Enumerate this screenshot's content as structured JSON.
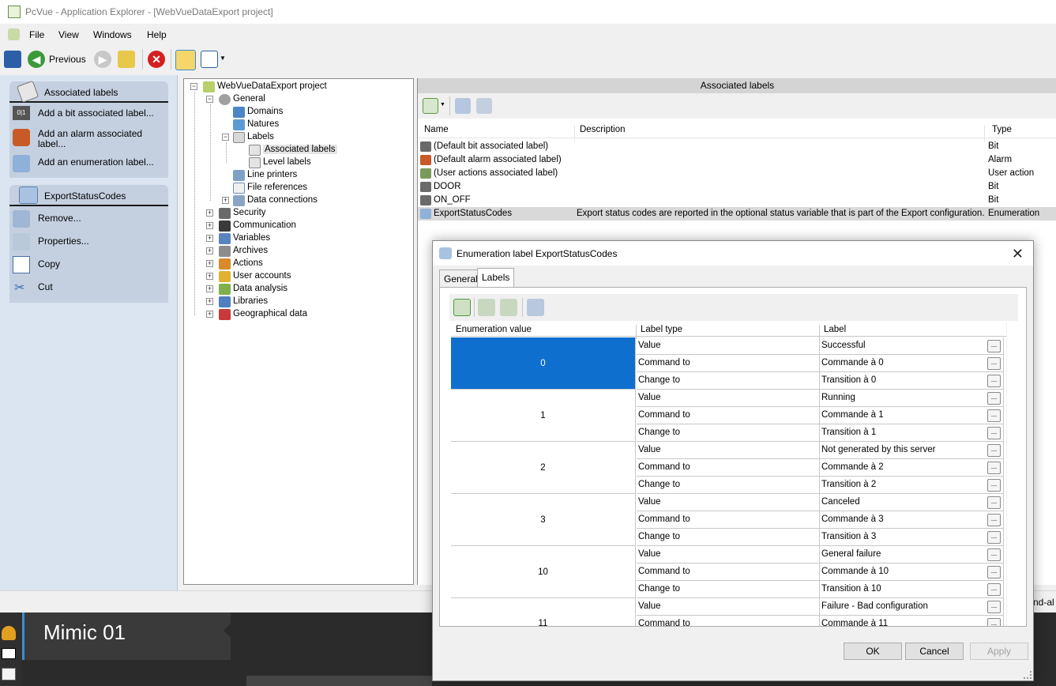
{
  "window": {
    "title": "PcVue - Application Explorer - [WebVueDataExport project]"
  },
  "menu": [
    "File",
    "View",
    "Windows",
    "Help"
  ],
  "toolbar": {
    "previous_label": "Previous"
  },
  "action_pane": {
    "group1": {
      "title": "Associated labels",
      "items": [
        "Add a bit associated label...",
        "Add an alarm associated label...",
        "Add an enumeration label..."
      ]
    },
    "group2": {
      "title": "ExportStatusCodes",
      "items": [
        "Remove...",
        "Properties...",
        "Copy",
        "Cut"
      ]
    }
  },
  "tree": {
    "root": "WebVueDataExport project",
    "general": "General",
    "general_children": [
      "Domains",
      "Natures",
      "Labels"
    ],
    "labels_children": [
      "Associated labels",
      "Level labels"
    ],
    "general_rest": [
      "Line printers",
      "File references",
      "Data connections"
    ],
    "top_level": [
      "Security",
      "Communication",
      "Variables",
      "Archives",
      "Actions",
      "User accounts",
      "Data analysis",
      "Libraries",
      "Geographical data"
    ]
  },
  "list": {
    "header": "Associated labels",
    "columns": {
      "name": "Name",
      "description": "Description",
      "type": "Type"
    },
    "rows": [
      {
        "name": "(Default bit associated label)",
        "description": "",
        "type": "Bit"
      },
      {
        "name": "(Default alarm associated label)",
        "description": "",
        "type": "Alarm"
      },
      {
        "name": "(User actions associated label)",
        "description": "",
        "type": "User action"
      },
      {
        "name": "DOOR",
        "description": "",
        "type": "Bit"
      },
      {
        "name": "ON_OFF",
        "description": "",
        "type": "Bit"
      },
      {
        "name": "ExportStatusCodes",
        "description": "Export status codes are reported in the optional status variable that is part of the Export configuration.",
        "type": "Enumeration"
      }
    ]
  },
  "status_bar": {
    "right_text": "nd-al"
  },
  "mimic": {
    "title": "Mimic 01"
  },
  "dialog": {
    "title": "Enumeration label ExportStatusCodes",
    "tabs": [
      "General",
      "Labels"
    ],
    "columns": {
      "enum": "Enumeration value",
      "type": "Label type",
      "label": "Label"
    },
    "groups": [
      {
        "value": "0",
        "rows": [
          [
            "Value",
            "Successful"
          ],
          [
            "Command to",
            "Commande à 0"
          ],
          [
            "Change to",
            "Transition à 0"
          ]
        ]
      },
      {
        "value": "1",
        "rows": [
          [
            "Value",
            "Running"
          ],
          [
            "Command to",
            "Commande à 1"
          ],
          [
            "Change to",
            "Transition à 1"
          ]
        ]
      },
      {
        "value": "2",
        "rows": [
          [
            "Value",
            "Not generated by this server"
          ],
          [
            "Command to",
            "Commande à 2"
          ],
          [
            "Change to",
            "Transition à 2"
          ]
        ]
      },
      {
        "value": "3",
        "rows": [
          [
            "Value",
            "Canceled"
          ],
          [
            "Command to",
            "Commande à 3"
          ],
          [
            "Change to",
            "Transition à 3"
          ]
        ]
      },
      {
        "value": "10",
        "rows": [
          [
            "Value",
            "General failure"
          ],
          [
            "Command to",
            "Commande à 10"
          ],
          [
            "Change to",
            "Transition à 10"
          ]
        ]
      },
      {
        "value": "11",
        "rows": [
          [
            "Value",
            "Failure - Bad configuration"
          ],
          [
            "Command to",
            "Commande à 11"
          ]
        ]
      }
    ],
    "buttons": {
      "ok": "OK",
      "cancel": "Cancel",
      "apply": "Apply"
    },
    "ellipsis": "..."
  },
  "colors": {
    "selection": "#0f6fcf",
    "accent": "#3b8fd1"
  }
}
